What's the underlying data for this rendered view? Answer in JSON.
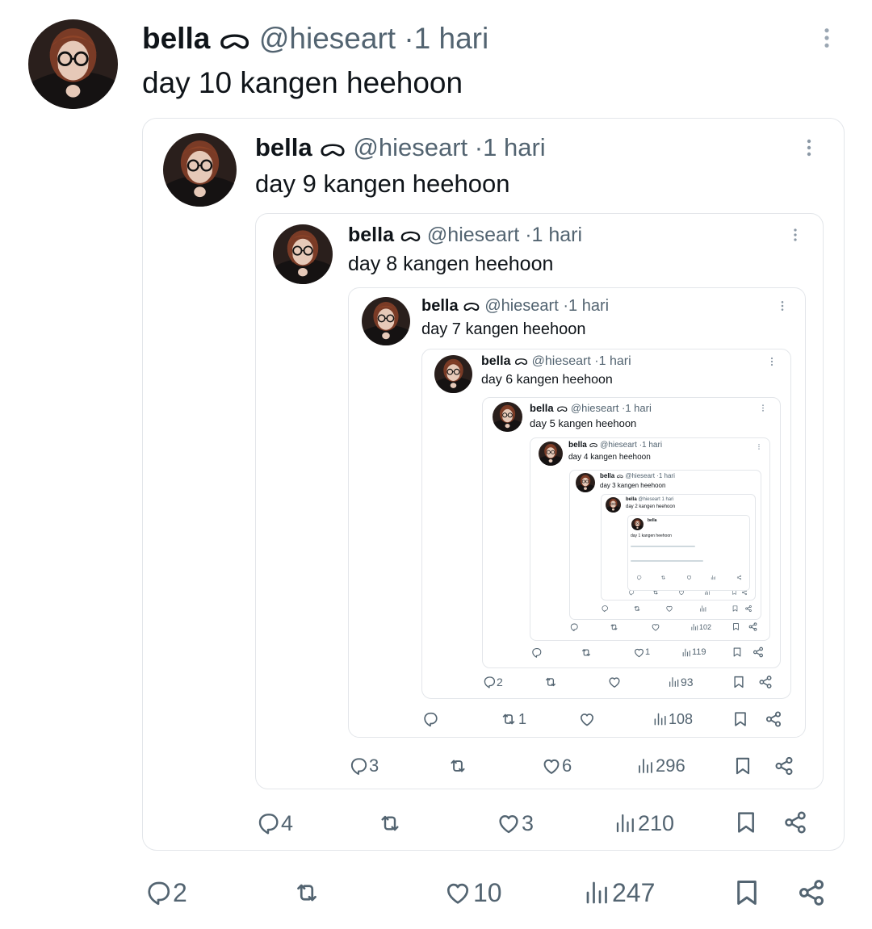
{
  "author": {
    "name": "bella",
    "name_glyph": "ᯅ",
    "handle": "@hieseart",
    "time": "1 hari"
  },
  "levels": [
    {
      "text": "day 10 kangen heehoon",
      "reply": "2",
      "retweet": "",
      "like": "10",
      "views": "247"
    },
    {
      "text": "day 9 kangen heehoon",
      "reply": "4",
      "retweet": "",
      "like": "3",
      "views": "210"
    },
    {
      "text": "day 8 kangen heehoon",
      "reply": "3",
      "retweet": "",
      "like": "6",
      "views": "296"
    },
    {
      "text": "day 7 kangen heehoon",
      "reply": "",
      "retweet": "1",
      "like": "",
      "views": "108"
    },
    {
      "text": "day 6 kangen heehoon",
      "reply": "2",
      "retweet": "",
      "like": "",
      "views": "93"
    },
    {
      "text": "day 5 kangen heehoon",
      "reply": "",
      "retweet": "",
      "like": "1",
      "views": "119"
    },
    {
      "text": "day 4 kangen heehoon",
      "reply": "",
      "retweet": "",
      "like": "",
      "views": "102"
    },
    {
      "text": "day 3 kangen heehoon"
    },
    {
      "text": "day 2 kangen heehoon"
    },
    {
      "text": "day 1 kangen heehoon"
    }
  ],
  "icons": {
    "more": "more-vertical-icon",
    "reply": "reply-icon",
    "retweet": "retweet-icon",
    "like": "heart-icon",
    "views": "views-icon",
    "bookmark": "bookmark-icon",
    "share": "share-icon"
  },
  "colors": {
    "text": "#0f1419",
    "secondary": "#536471",
    "border": "#e3e6ea"
  }
}
